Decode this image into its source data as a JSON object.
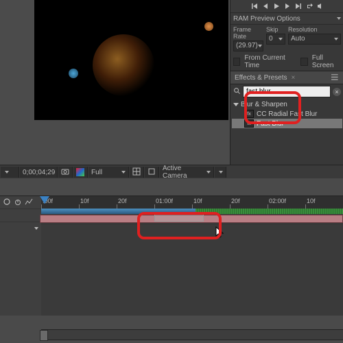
{
  "preview": {
    "ram_options_label": "RAM Preview Options",
    "framerate_label": "Frame Rate",
    "framerate_value": "(29.97)",
    "skip_label": "Skip",
    "skip_value": "0",
    "resolution_label": "Resolution",
    "resolution_value": "Auto",
    "from_current_time_label": "From Current Time",
    "full_screen_label": "Full Screen"
  },
  "effects_panel": {
    "title": "Effects & Presets",
    "search_value": "fast blur",
    "category": "Blur & Sharpen",
    "items": [
      {
        "label": "CC Radial Fast Blur",
        "selected": false
      },
      {
        "label": "Fast Blur",
        "selected": true
      }
    ]
  },
  "comp_footer": {
    "zoom": "",
    "timecode": "0;00;04;29",
    "mag": "Full",
    "camera": "Active Camera"
  },
  "timeline": {
    "ruler": [
      {
        "label": ":00f",
        "pos": 0
      },
      {
        "label": "10f",
        "pos": 55
      },
      {
        "label": "20f",
        "pos": 110
      },
      {
        "label": "01:00f",
        "pos": 165
      },
      {
        "label": "10f",
        "pos": 220
      },
      {
        "label": "20f",
        "pos": 275
      },
      {
        "label": "02:00f",
        "pos": 330
      },
      {
        "label": "10f",
        "pos": 385
      }
    ]
  },
  "icons": {
    "first": "first-frame-icon",
    "prev": "prev-frame-icon",
    "play": "play-icon",
    "next": "next-frame-icon",
    "last": "last-frame-icon",
    "loop": "loop-icon",
    "mute": "mute-icon"
  }
}
